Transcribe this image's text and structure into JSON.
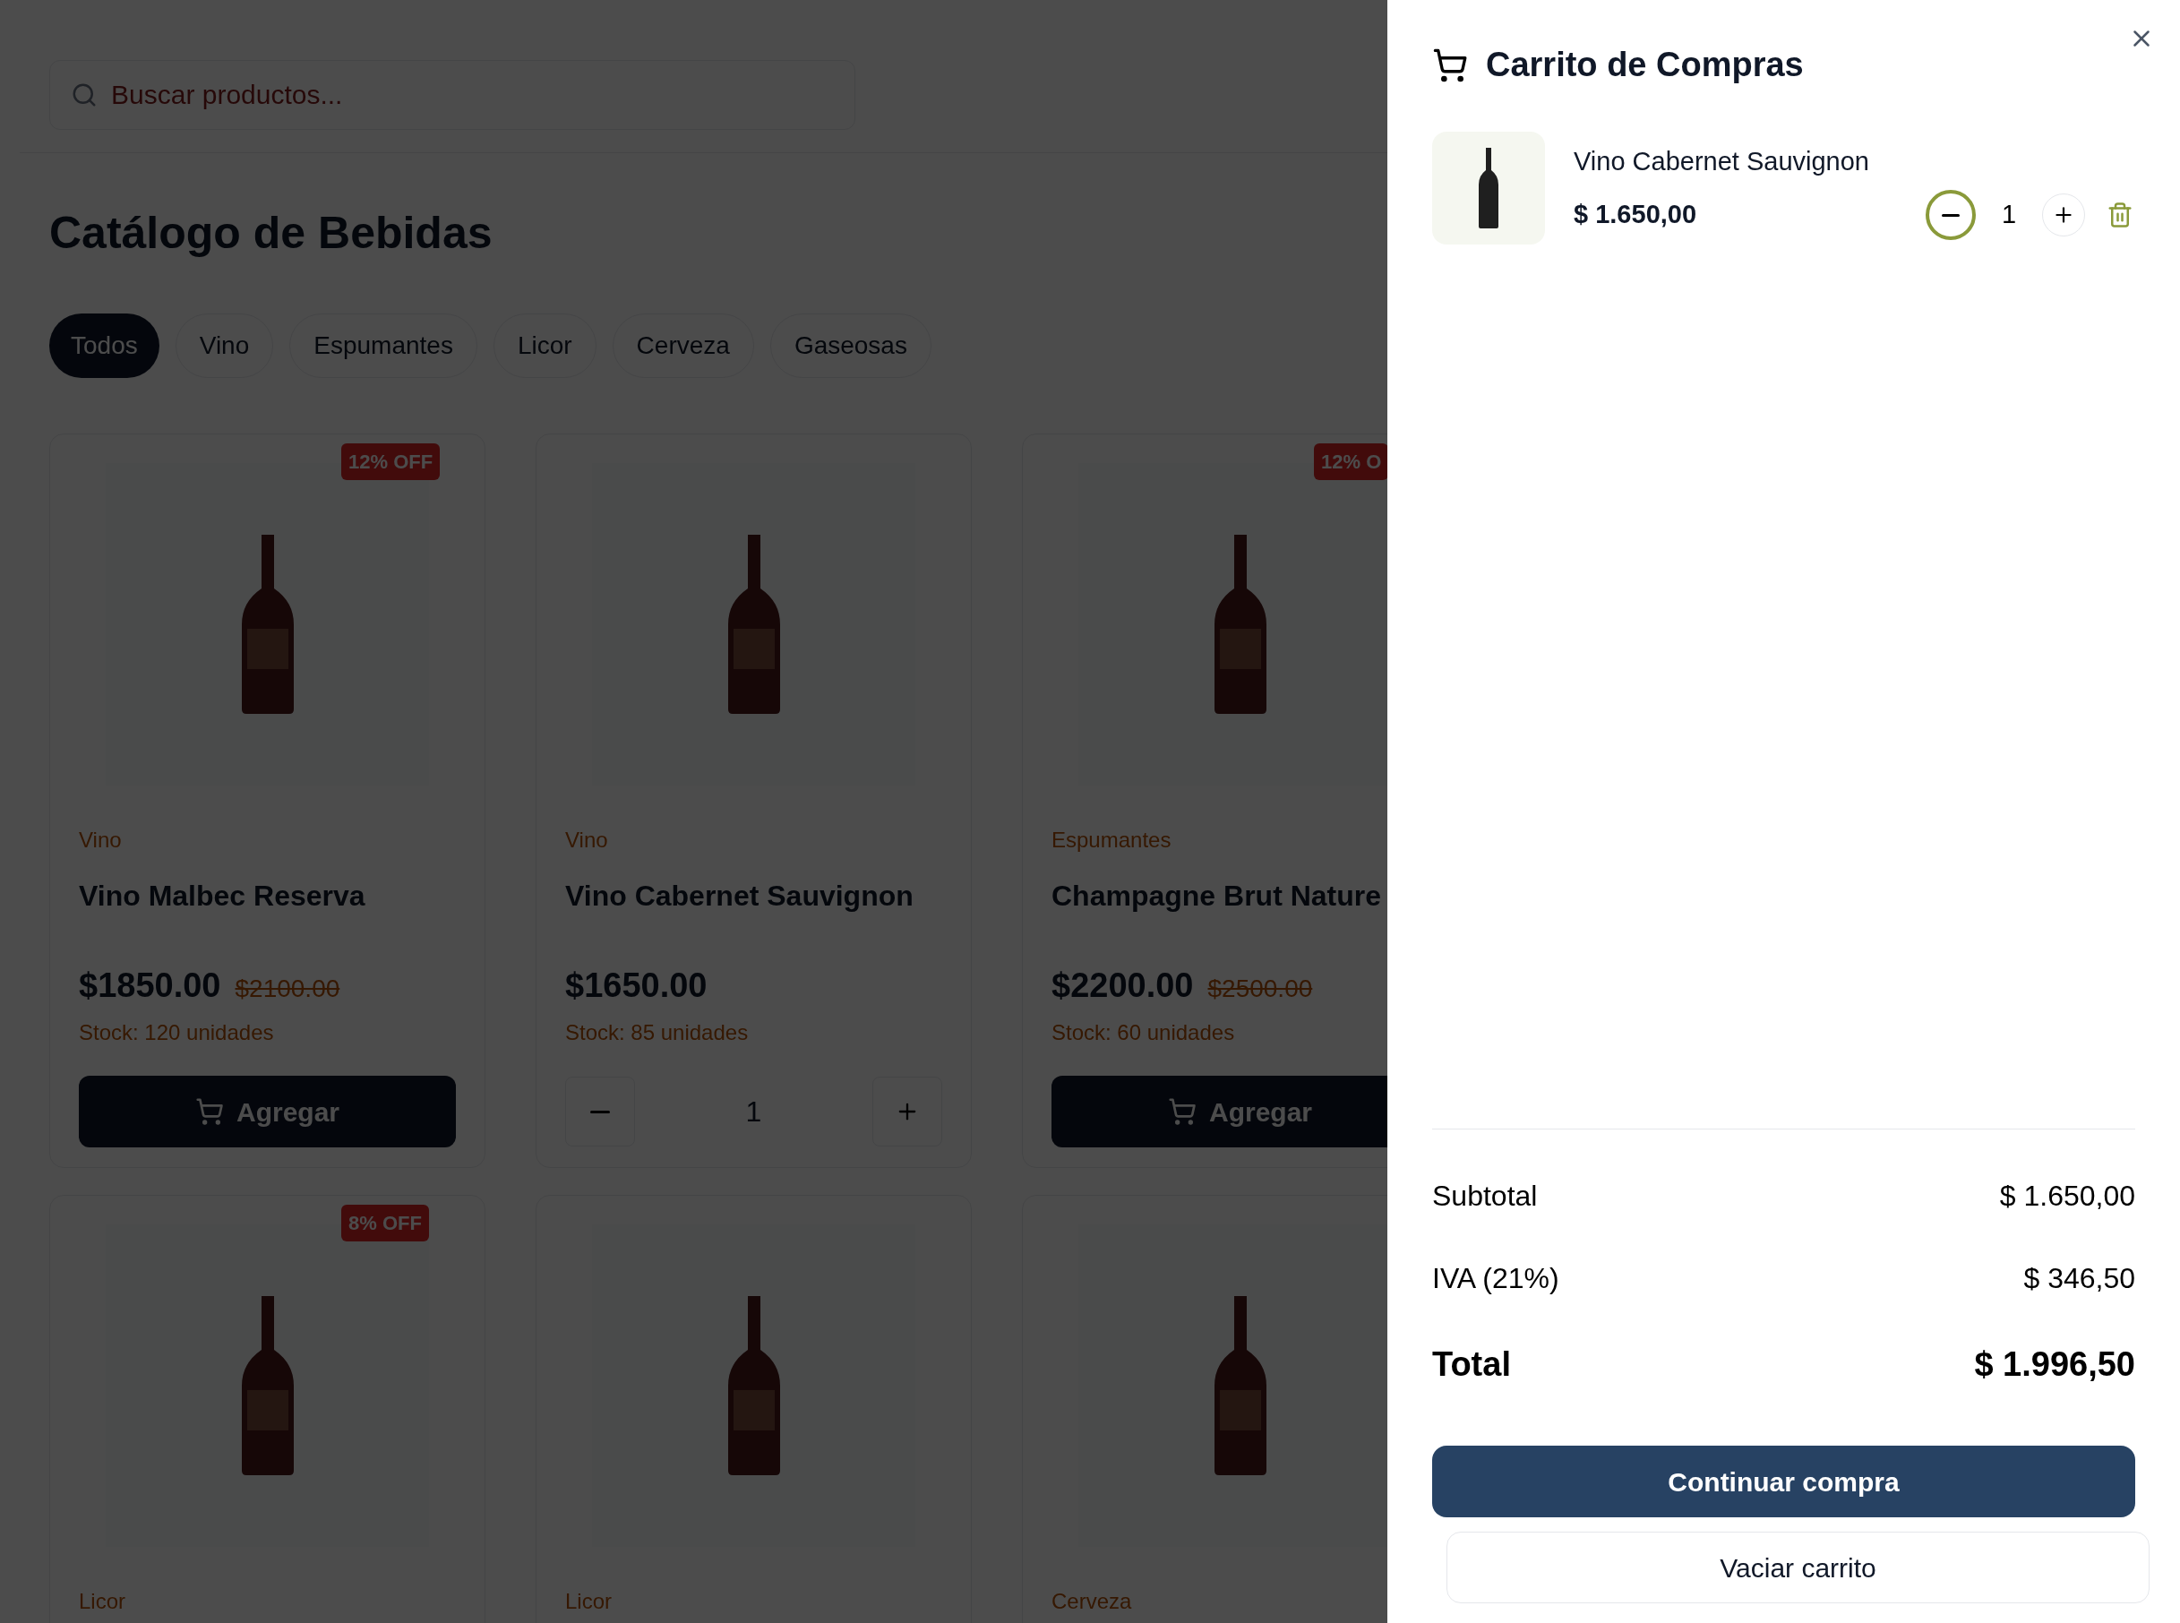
{
  "search": {
    "placeholder": "Buscar productos..."
  },
  "catalog": {
    "title": "Catálogo de Bebidas",
    "categories": [
      {
        "label": "Todos",
        "selected": true
      },
      {
        "label": "Vino",
        "selected": false
      },
      {
        "label": "Espumantes",
        "selected": false
      },
      {
        "label": "Licor",
        "selected": false
      },
      {
        "label": "Cerveza",
        "selected": false
      },
      {
        "label": "Gaseosas",
        "selected": false
      }
    ],
    "products": [
      {
        "badge": "12% OFF",
        "category": "Vino",
        "name": "Vino Malbec Reserva",
        "price": "$1850.00",
        "old_price": "$2100.00",
        "stock": "Stock: 120 unidades",
        "action": {
          "kind": "add",
          "label": "Agregar"
        }
      },
      {
        "category": "Vino",
        "name": "Vino Cabernet Sauvignon",
        "price": "$1650.00",
        "stock": "Stock: 85 unidades",
        "action": {
          "kind": "stepper",
          "quantity": "1"
        }
      },
      {
        "badge": "12% O",
        "category": "Espumantes",
        "name": "Champagne Brut Nature",
        "price": "$2200.00",
        "old_price": "$2500.00",
        "stock": "Stock: 60 unidades",
        "action": {
          "kind": "add",
          "label": "Agregar"
        }
      },
      {
        "badge": "8% OFF",
        "category": "Licor"
      },
      {
        "category": "Licor"
      },
      {
        "category": "Cerveza"
      }
    ]
  },
  "cart": {
    "title": "Carrito de Compras",
    "items": [
      {
        "name": "Vino Cabernet Sauvignon",
        "price": "$ 1.650,00",
        "quantity": "1",
        "decrement_focused": true
      }
    ],
    "summary": [
      {
        "kind": "line",
        "label": "Subtotal",
        "value": "$ 1.650,00"
      },
      {
        "kind": "line",
        "label": "IVA (21%)",
        "value": "$ 346,50"
      },
      {
        "kind": "total",
        "label": "Total",
        "value": "$ 1.996,50"
      }
    ],
    "primary_button": "Continuar compra",
    "secondary_button": "Vaciar carrito"
  }
}
